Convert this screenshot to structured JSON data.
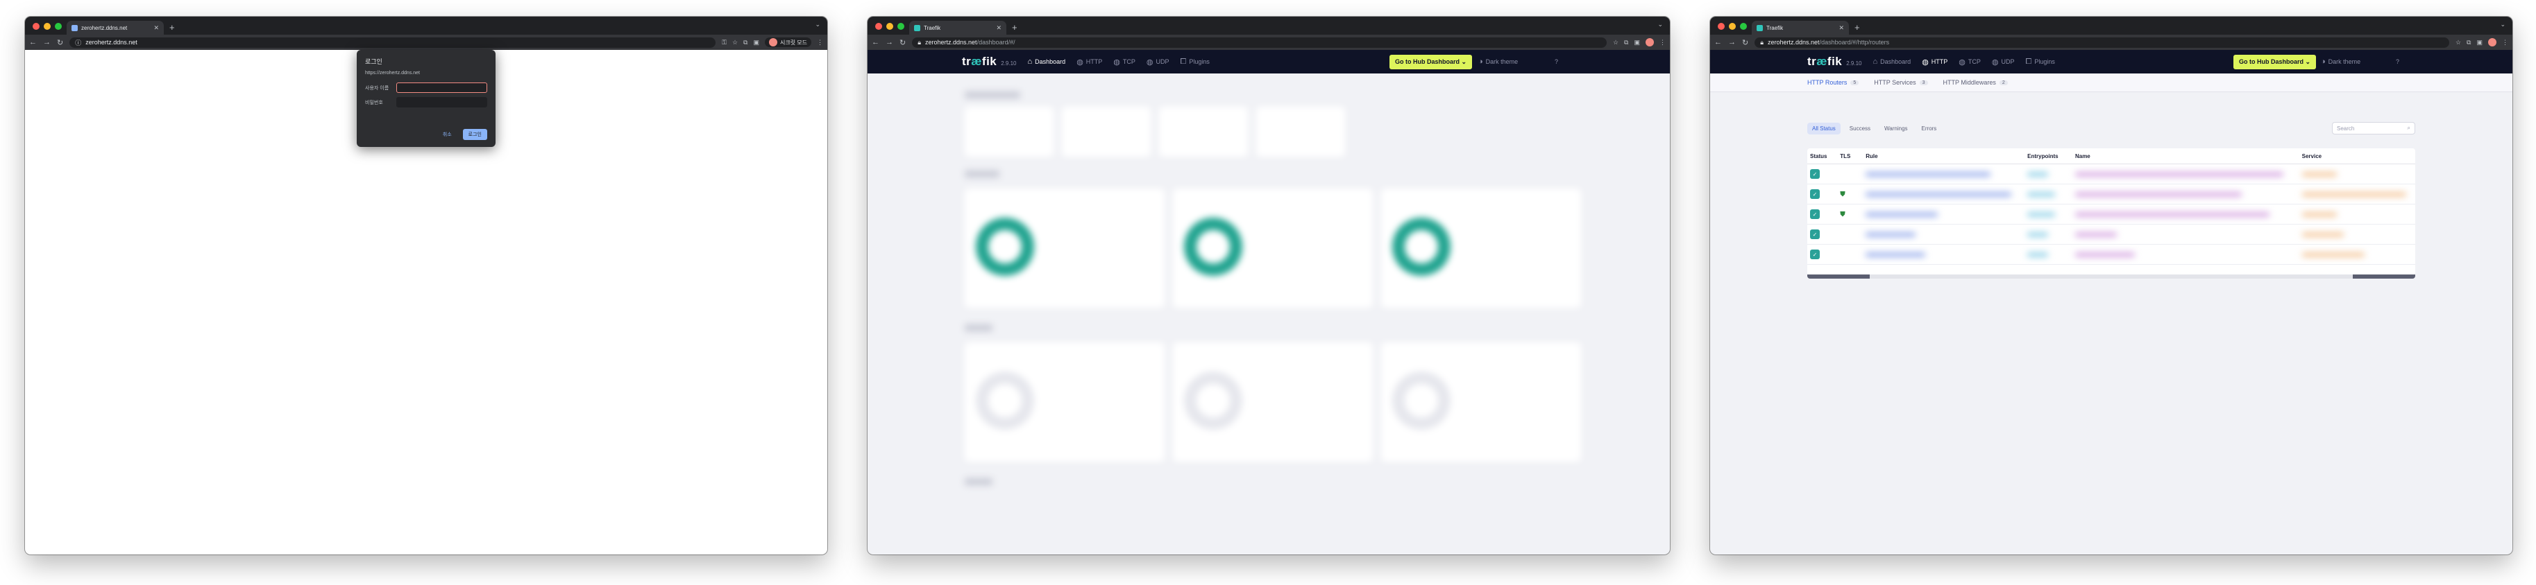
{
  "window1": {
    "tab_title": "zerohertz.ddns.net",
    "url": "zerohertz.ddns.net",
    "profile_label": "시크릿 모드",
    "dialog": {
      "title": "로그인",
      "origin": "https://zerohertz.ddns.net",
      "username_label": "사용자 이름",
      "password_label": "비밀번호",
      "cancel_label": "취소",
      "login_label": "로그인"
    }
  },
  "window2": {
    "tab_title": "Traefik",
    "url_host": "zerohertz.ddns.net",
    "url_path": "/dashboard/#/",
    "nav": {
      "brand_a": "tr",
      "brand_b": "æ",
      "brand_c": "fik",
      "version": "2.9.10",
      "items": [
        "Dashboard",
        "HTTP",
        "TCP",
        "UDP",
        "Plugins"
      ],
      "hub_button": "Go to Hub Dashboard ⌄",
      "theme": "Dark theme"
    }
  },
  "window3": {
    "tab_title": "Traefik",
    "url_host": "zerohertz.ddns.net",
    "url_path": "/dashboard/#/http/routers",
    "nav": {
      "brand_a": "tr",
      "brand_b": "æ",
      "brand_c": "fik",
      "version": "2.9.10",
      "items": [
        "Dashboard",
        "HTTP",
        "TCP",
        "UDP",
        "Plugins"
      ],
      "hub_button": "Go to Hub Dashboard ⌄",
      "theme": "Dark theme"
    },
    "subtabs": [
      {
        "label": "HTTP Routers",
        "count": "5"
      },
      {
        "label": "HTTP Services",
        "count": "3"
      },
      {
        "label": "HTTP Middlewares",
        "count": "2"
      }
    ],
    "filters": [
      "All Status",
      "Success",
      "Warnings",
      "Errors"
    ],
    "search_placeholder": "Search",
    "columns": [
      "Status",
      "TLS",
      "Rule",
      "Entrypoints",
      "Name",
      "Service"
    ]
  },
  "colors": {
    "traefik_nav": "#0f1327",
    "hub_button": "#ddf45b",
    "accent": "#3661d7",
    "status_ok": "#2aa198"
  }
}
